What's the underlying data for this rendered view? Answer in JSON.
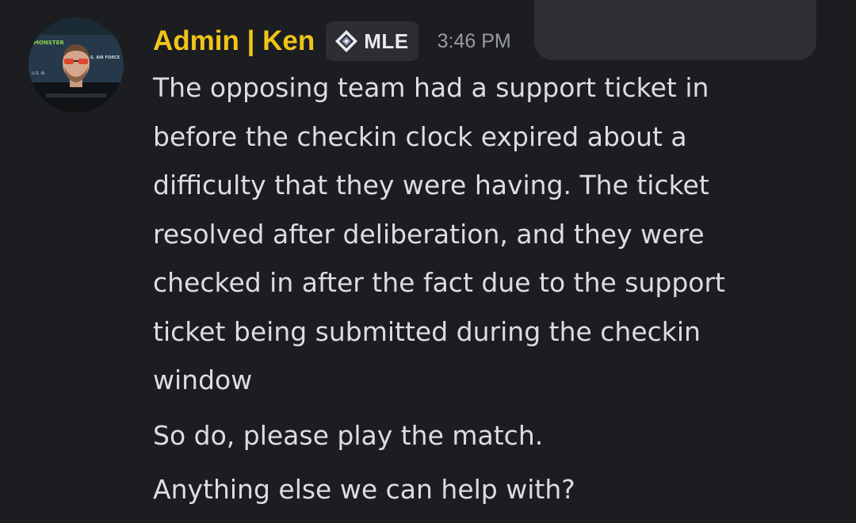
{
  "message": {
    "author": "Admin | Ken",
    "role_tag": {
      "icon": "diamond-icon",
      "label": "MLE"
    },
    "timestamp": "3:46 PM",
    "avatar": {
      "banner_text_1": "MONSTER",
      "banner_text_2": "U.S. AIR FORCE",
      "banner_text_3": "U.S. AI"
    },
    "paragraph_1_lines": [
      "The opposing team had a support ticket in",
      "before the checkin clock expired about a",
      "difficulty that they were having. The ticket",
      "resolved after deliberation, and they were",
      "checked in after the fact due to the support",
      "ticket being submitted during the checkin",
      "window"
    ],
    "paragraph_2": "So do, please play the match.",
    "paragraph_3": "Anything else we can help with?"
  },
  "colors": {
    "background": "#1c1d21",
    "username": "#f0c419",
    "text": "#dcdde1",
    "timestamp": "#989aa2",
    "tag_bg": "#2c2e34"
  }
}
